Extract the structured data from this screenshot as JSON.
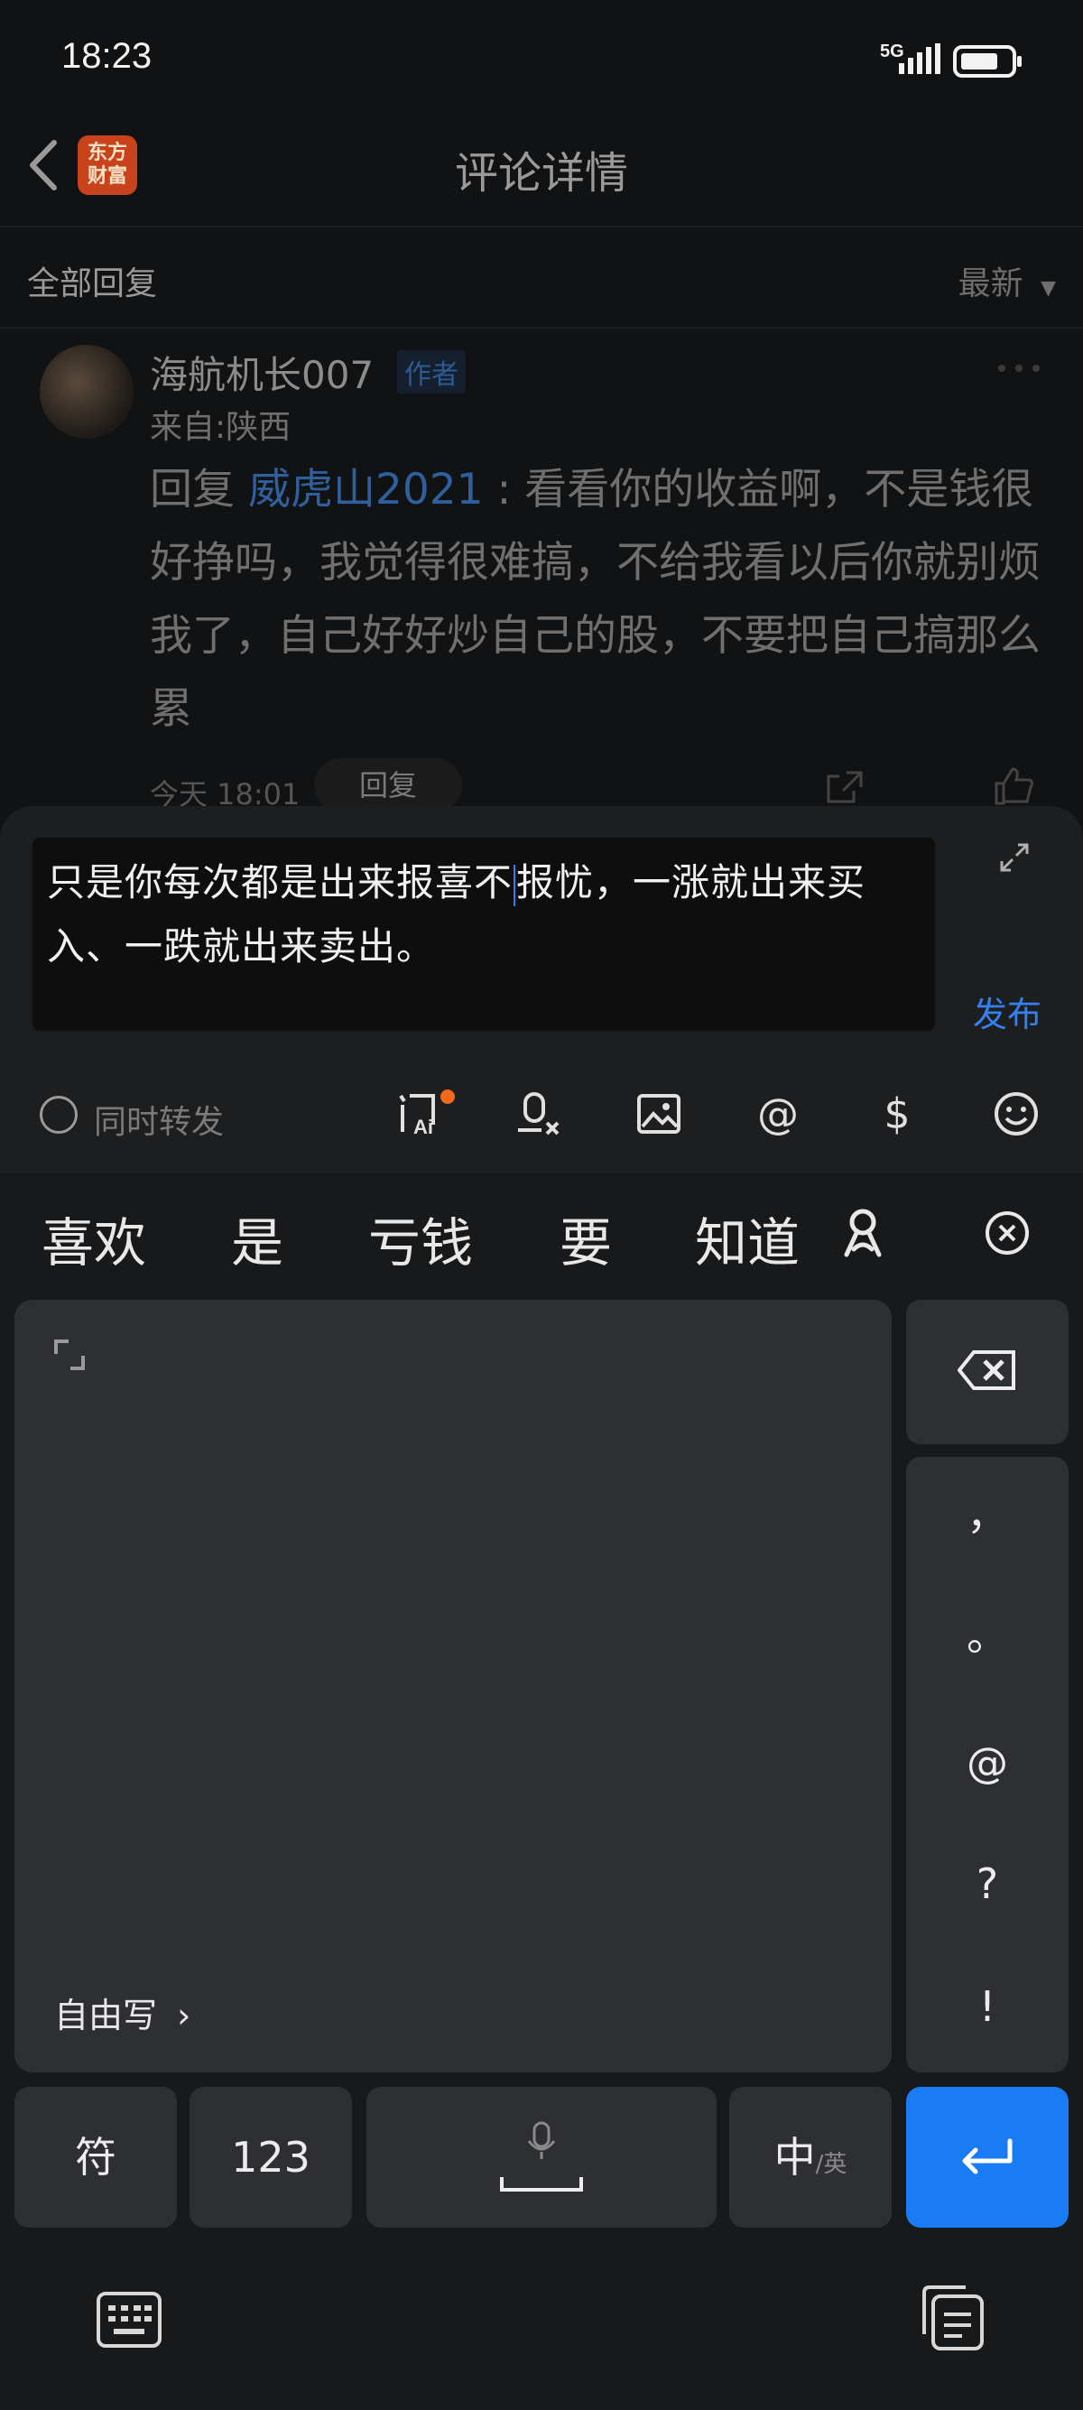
{
  "status_bar": {
    "time": "18:23",
    "network": "5G"
  },
  "header": {
    "title": "评论详情",
    "logo_text": "东方\n财富"
  },
  "filter": {
    "section": "全部回复",
    "sort": "最新"
  },
  "comment": {
    "user": "海航机长007",
    "badge": "作者",
    "location": "来自:陕西",
    "reply_prefix": "回复",
    "reply_to": "威虎山2021",
    "text": " : 看看你的收益啊，不是钱很好挣吗，我觉得很难搞，不给我看以后你就别烦我了，自己好好炒自己的股，不要把自己搞那么累",
    "time": "今天 18:01",
    "reply_button": "回复"
  },
  "composer": {
    "text_before_caret": "只是你每次都是出来报喜不",
    "text_after_caret": "报忧，一涨就出来买入、一跌就出来卖出。",
    "publish": "发布",
    "repost_label": "同时转发",
    "tools": [
      "ai-question-icon",
      "voice-to-text-icon",
      "image-icon",
      "at-icon",
      "dollar-icon",
      "emoji-icon"
    ]
  },
  "keyboard": {
    "candidates": [
      "喜欢",
      "是",
      "亏钱",
      "要",
      "知道"
    ],
    "freewrite": "自由写",
    "punctuation": [
      "，",
      "。",
      "@",
      "?",
      "!"
    ],
    "symbols_key": "符",
    "numbers_key": "123",
    "lang_key_main": "中",
    "lang_key_sub": "/英",
    "accent_color": "#1a7cf5"
  }
}
